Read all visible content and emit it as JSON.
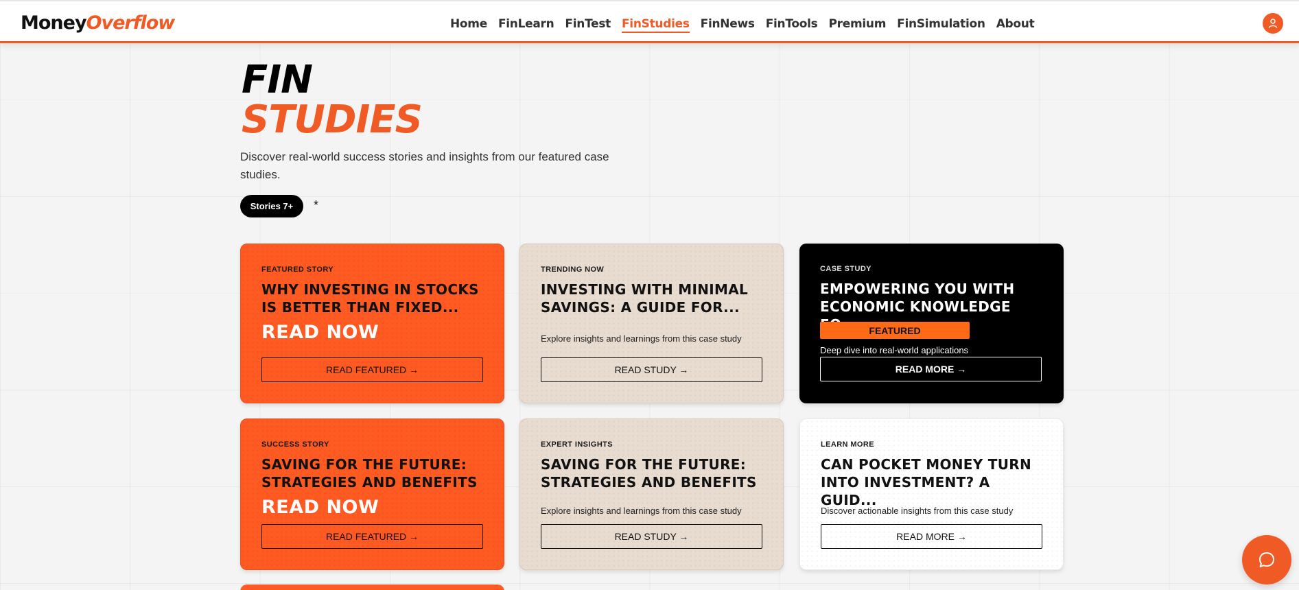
{
  "brand": {
    "part1": "Money",
    "part2": "Overflow",
    "accent_color": "#f05a24"
  },
  "nav": {
    "items": [
      {
        "label": "Home",
        "active": false
      },
      {
        "label": "FinLearn",
        "active": false
      },
      {
        "label": "FinTest",
        "active": false
      },
      {
        "label": "FinStudies",
        "active": true
      },
      {
        "label": "FinNews",
        "active": false
      },
      {
        "label": "FinTools",
        "active": false
      },
      {
        "label": "Premium",
        "active": false
      },
      {
        "label": "FinSimulation",
        "active": false
      },
      {
        "label": "About",
        "active": false
      }
    ],
    "user_icon": "user-icon"
  },
  "hero": {
    "title_line1": "FIN",
    "title_line2": "STUDIES",
    "description": "Discover real-world success stories and insights from our featured case studies.",
    "stories_pill": "Stories 7+",
    "asterisk": "*"
  },
  "cards": [
    {
      "tag": "FEATURED STORY",
      "title": "WHY INVESTING IN STOCKS IS BETTER THAN FIXED...",
      "highlight": "READ NOW",
      "button": "READ FEATURED →",
      "theme": "orange"
    },
    {
      "tag": "TRENDING NOW",
      "title": "INVESTING WITH MINIMAL SAVINGS: A GUIDE FOR...",
      "description": "Explore insights and learnings from this case study",
      "button": "READ STUDY →",
      "theme": "beige"
    },
    {
      "tag": "CASE STUDY",
      "title": "EMPOWERING YOU WITH ECONOMIC KNOWLEDGE FO...",
      "badge": "FEATURED",
      "description": "Deep dive into real-world applications",
      "button": "READ MORE →",
      "theme": "black"
    },
    {
      "tag": "SUCCESS STORY",
      "title": "SAVING FOR THE FUTURE: STRATEGIES AND BENEFITS",
      "highlight": "READ NOW",
      "button": "READ FEATURED →",
      "theme": "orange"
    },
    {
      "tag": "EXPERT INSIGHTS",
      "title": "SAVING FOR THE FUTURE: STRATEGIES AND BENEFITS",
      "description": "Explore insights and learnings from this case study",
      "button": "READ STUDY →",
      "theme": "beige"
    },
    {
      "tag": "LEARN MORE",
      "title": "CAN POCKET MONEY TURN INTO INVESTMENT? A GUID...",
      "description": "Discover actionable insights from this case study",
      "button": "READ MORE →",
      "theme": "white"
    }
  ],
  "chat": {
    "icon": "chat-bubble-icon"
  }
}
